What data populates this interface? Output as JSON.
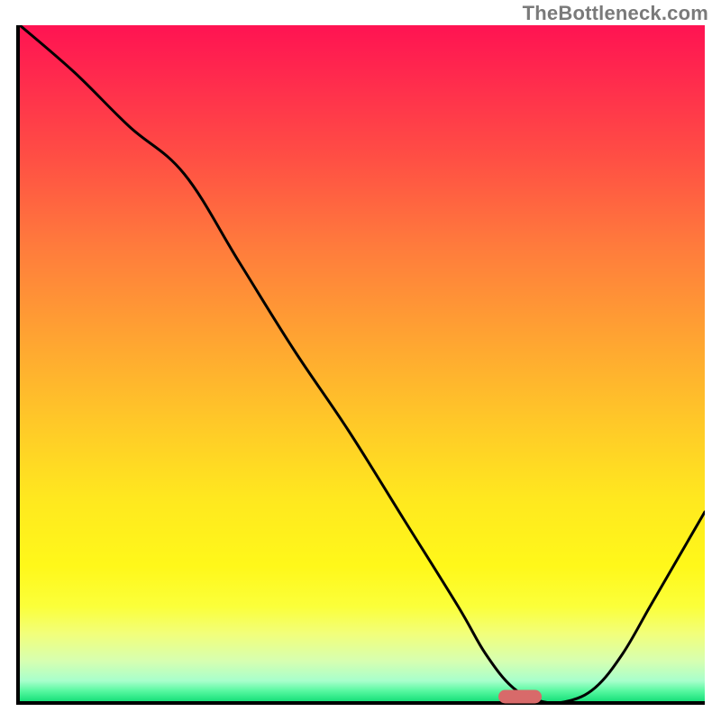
{
  "watermark": "TheBottleneck.com",
  "colors": {
    "axis": "#000000",
    "curve": "#000000",
    "marker": "#d86a6a",
    "watermark_text": "#7a7a7a"
  },
  "chart_data": {
    "type": "line",
    "title": "",
    "xlabel": "",
    "ylabel": "",
    "xlim": [
      0,
      100
    ],
    "ylim": [
      0,
      100
    ],
    "x": [
      0,
      8,
      16,
      24,
      32,
      40,
      48,
      56,
      64,
      68,
      72,
      76,
      80,
      84,
      88,
      92,
      96,
      100
    ],
    "values": [
      100,
      93,
      85,
      78,
      65,
      52,
      40,
      27,
      14,
      7,
      2,
      0,
      0,
      2,
      7,
      14,
      21,
      28
    ],
    "marker": {
      "x": 73,
      "y": 0.7
    },
    "notes": "V-shaped bottleneck curve: starts very high (≈100) at left edge, drops roughly linearly until trough near x≈74 where it reaches ~0 (flat segment), then rises again toward the right edge (~28 at x=100). Background is a vertical gradient from red→orange→yellow→green."
  }
}
